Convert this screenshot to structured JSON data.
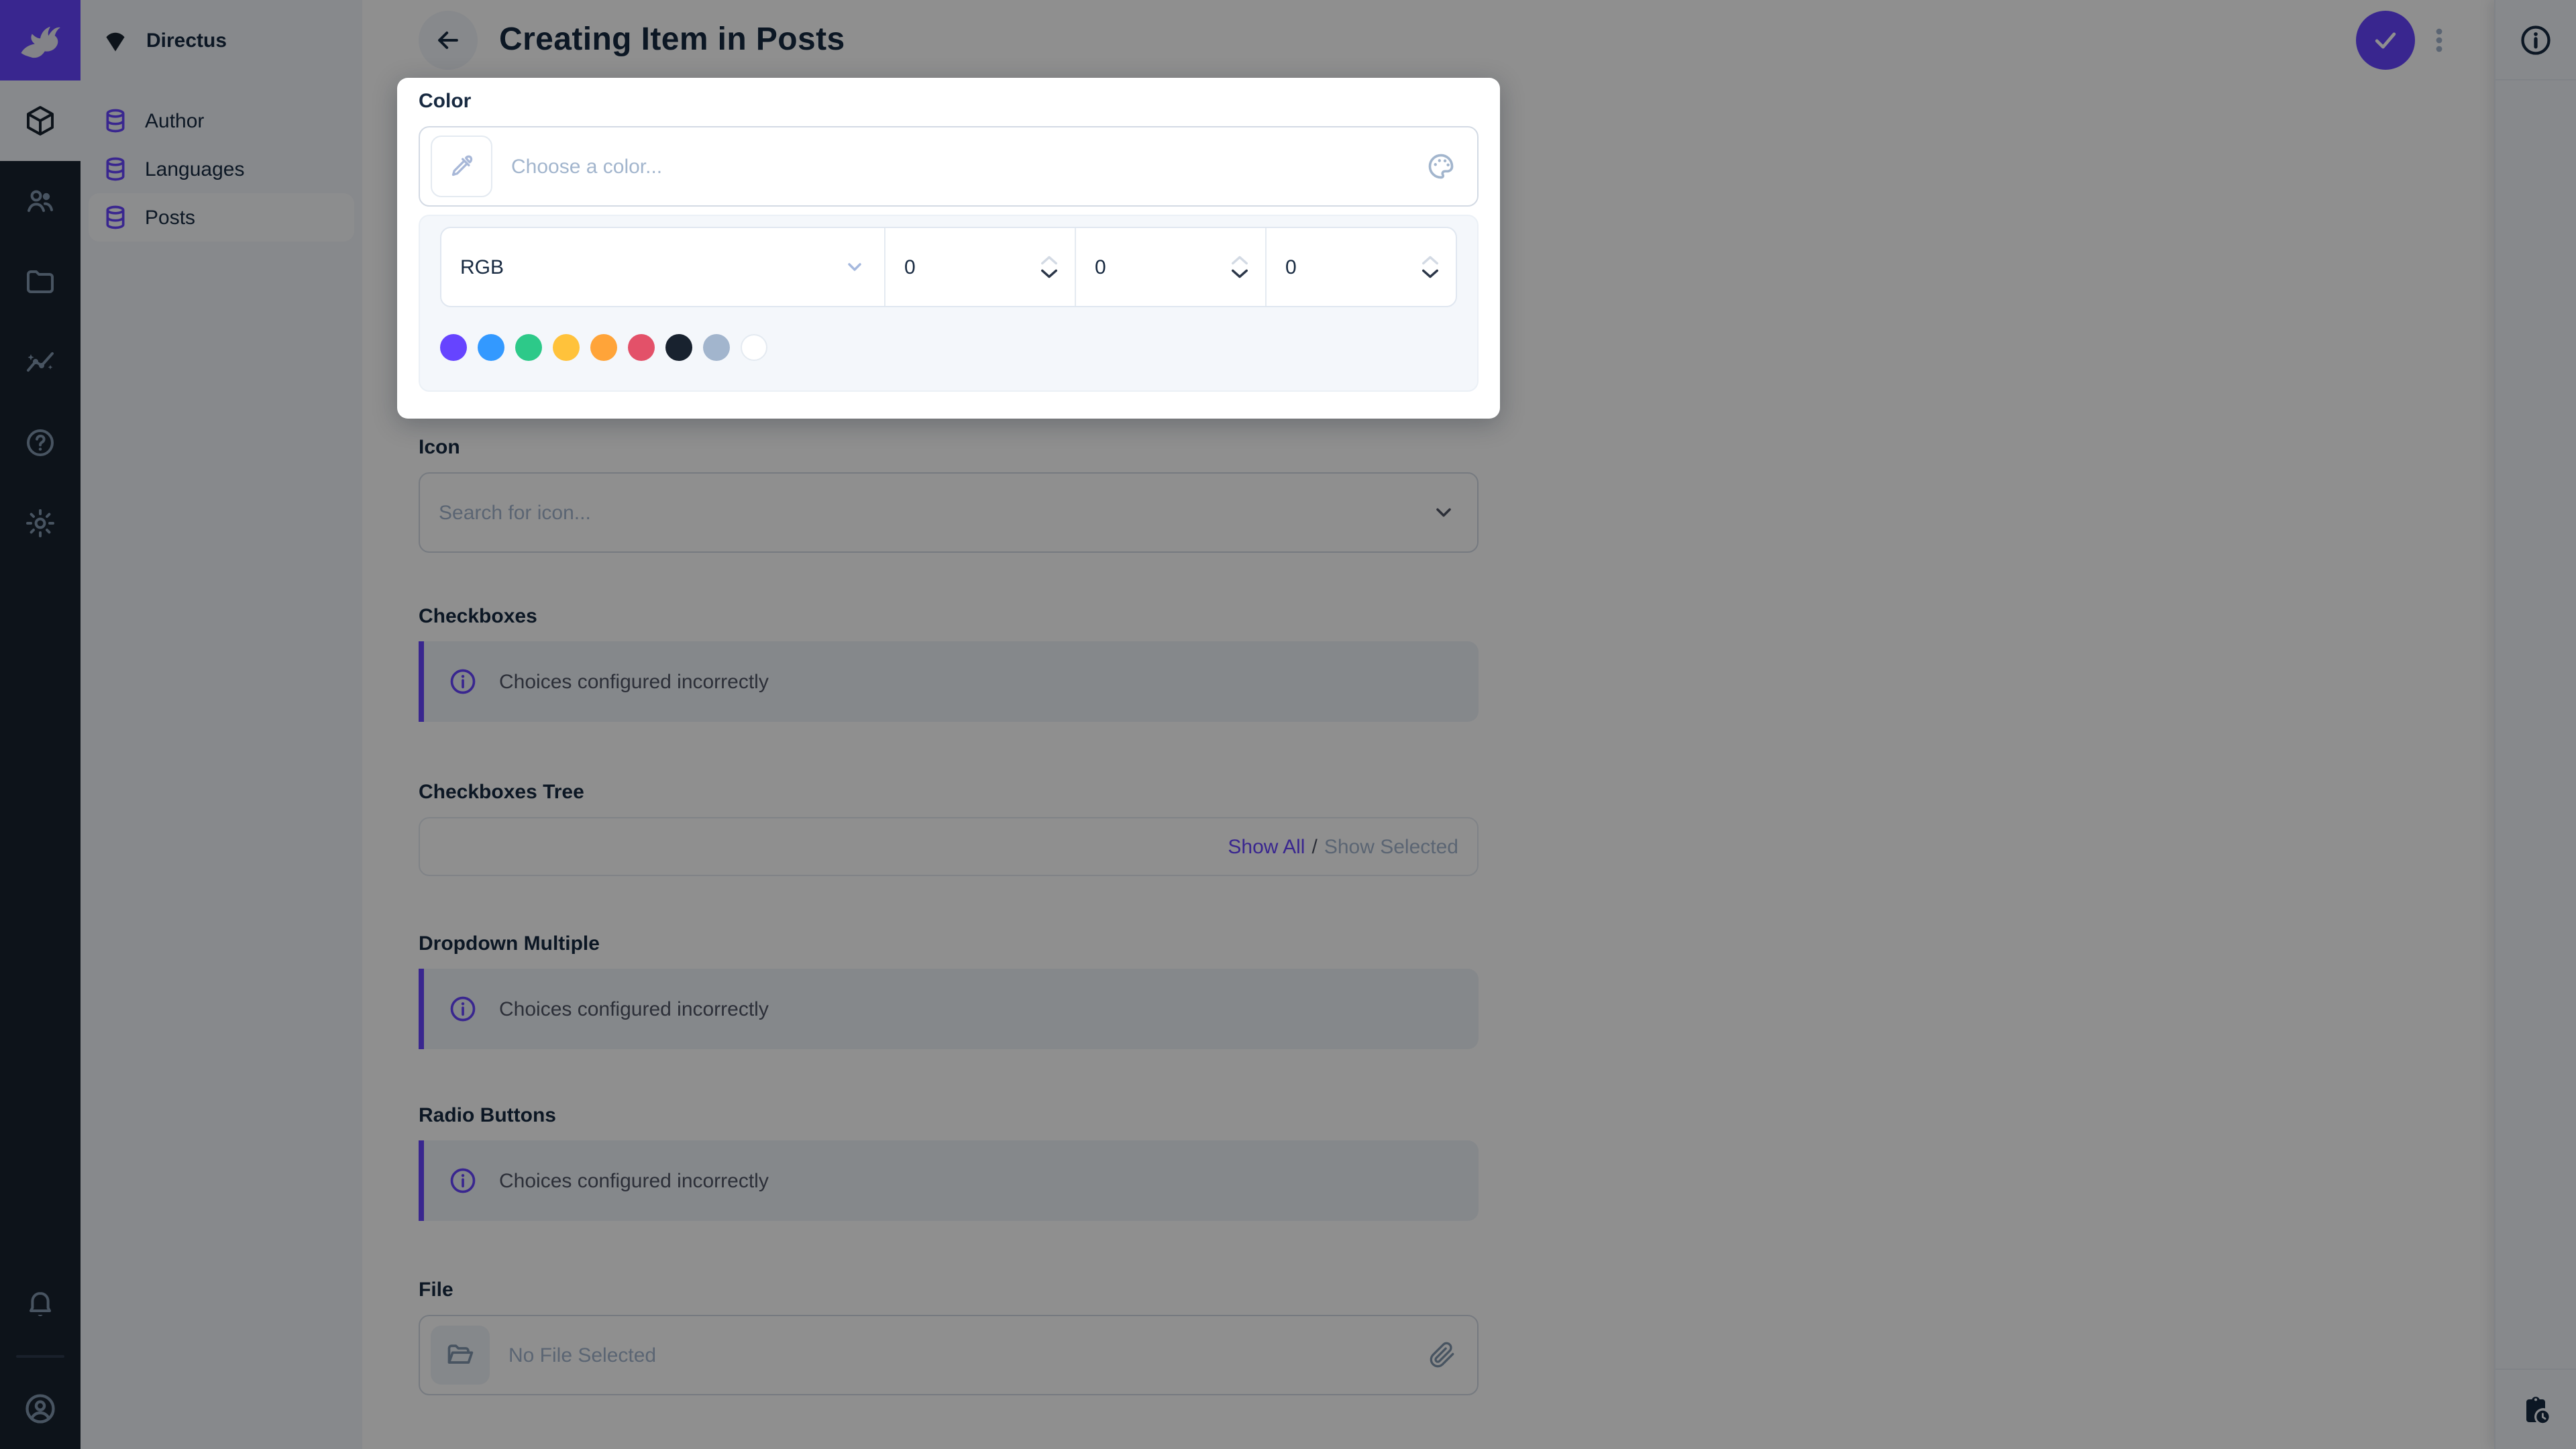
{
  "app": {
    "accent_color": "#6644FF",
    "module_bar_color": "#18222F",
    "nav_background": "#F0F4F9"
  },
  "module_bar": {
    "logo_icon": "directus-rabbit-icon",
    "modules": [
      {
        "icon": "box-icon",
        "active": true
      },
      {
        "icon": "people-icon",
        "active": false
      },
      {
        "icon": "folder-icon",
        "active": false
      },
      {
        "icon": "insights-icon",
        "active": false
      },
      {
        "icon": "help-circle-icon",
        "active": false
      },
      {
        "icon": "gear-icon",
        "active": false
      }
    ],
    "bottom": [
      {
        "icon": "bell-icon"
      },
      {
        "icon": "account-circle-icon"
      }
    ]
  },
  "nav": {
    "project_name": "Directus",
    "project_icon": "project-mark-icon",
    "items": [
      {
        "label": "Author",
        "icon": "database-icon",
        "active": false
      },
      {
        "label": "Languages",
        "icon": "database-icon",
        "active": false
      },
      {
        "label": "Posts",
        "icon": "database-icon",
        "active": true
      }
    ]
  },
  "header": {
    "title": "Creating Item in Posts",
    "back_icon": "arrow-left-icon",
    "save_icon": "check-icon",
    "more_icon": "dots-vertical-icon"
  },
  "right_sidebar": {
    "info_icon": "info-circle-icon",
    "bottom_icon": "pending-actions-icon"
  },
  "color_popover": {
    "label": "Color",
    "input_placeholder": "Choose a color...",
    "left_icon": "eyedropper-icon",
    "right_icon": "palette-icon",
    "mode": "RGB",
    "values": {
      "r": "0",
      "g": "0",
      "b": "0"
    },
    "swatches": [
      "#6644FF",
      "#3399FF",
      "#2DC989",
      "#FFC23B",
      "#FFA439",
      "#E35169",
      "#18222F",
      "#A2B5CD",
      "#FFFFFF"
    ]
  },
  "form": {
    "icon_field": {
      "label": "Icon",
      "placeholder": "Search for icon...",
      "chevron": "chevron-down-icon"
    },
    "checkboxes": {
      "label": "Checkboxes",
      "notice": "Choices configured incorrectly",
      "notice_icon": "info-circle-icon"
    },
    "checkboxes_tree": {
      "label": "Checkboxes Tree",
      "show_all": "Show All",
      "separator": "/",
      "show_selected": "Show Selected"
    },
    "dropdown_multiple": {
      "label": "Dropdown Multiple",
      "notice": "Choices configured incorrectly",
      "notice_icon": "info-circle-icon"
    },
    "radio_buttons": {
      "label": "Radio Buttons",
      "notice": "Choices configured incorrectly",
      "notice_icon": "info-circle-icon"
    },
    "file": {
      "label": "File",
      "placeholder": "No File Selected",
      "left_icon": "folder-open-icon",
      "right_icon": "paperclip-icon"
    }
  }
}
